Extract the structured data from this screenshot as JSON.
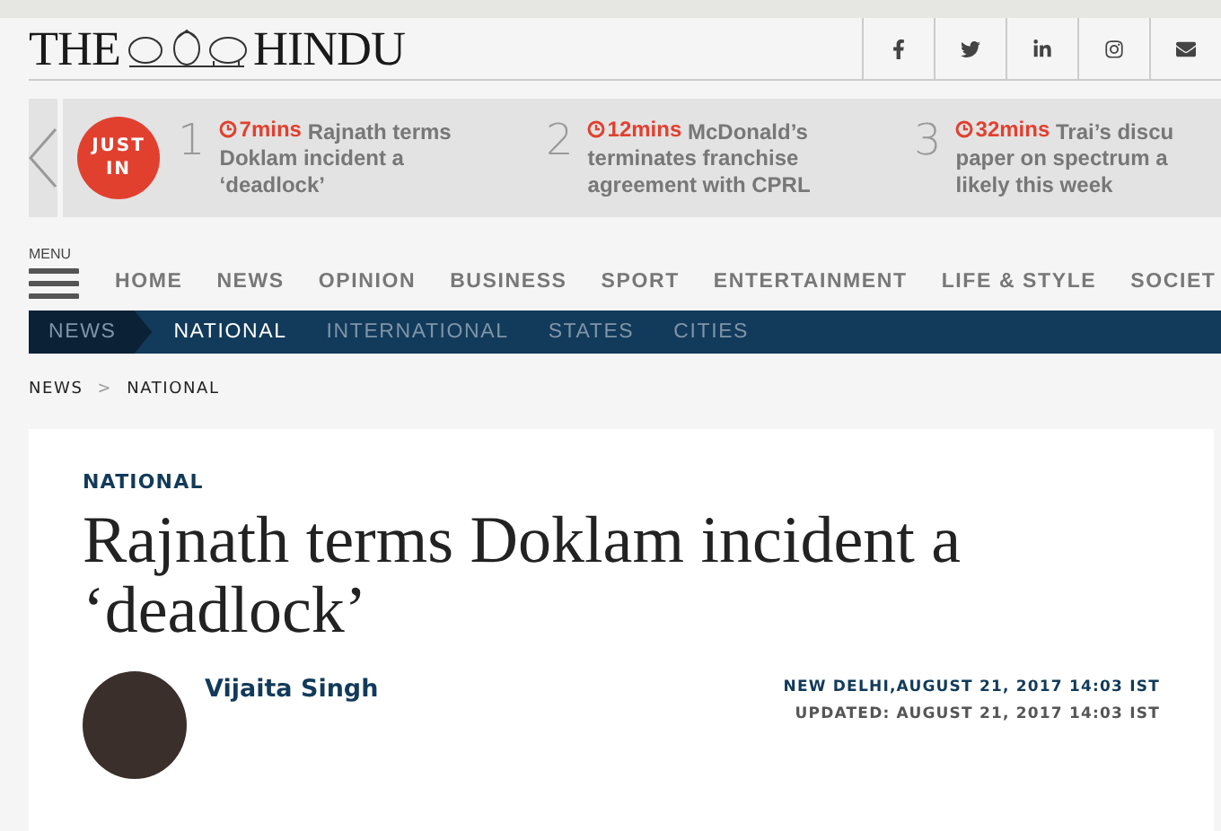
{
  "header": {
    "logo_left": "THE",
    "logo_right": "HINDU",
    "social": [
      {
        "kind": "facebook"
      },
      {
        "kind": "twitter"
      },
      {
        "kind": "linkedin"
      },
      {
        "kind": "instagram"
      },
      {
        "kind": "email"
      }
    ]
  },
  "just_in": {
    "badge": "JUST IN",
    "items": [
      {
        "number": "1",
        "time": "7mins",
        "lines": [
          "Rajnath terms",
          "Doklam incident a",
          "‘deadlock’"
        ]
      },
      {
        "number": "2",
        "time": "12mins",
        "lines": [
          "McDonald’s",
          "terminates franchise",
          "agreement with CPRL"
        ]
      },
      {
        "number": "3",
        "time": "32mins",
        "lines": [
          "Trai’s discu",
          "paper on spectrum a",
          "likely this week"
        ]
      }
    ]
  },
  "menu": {
    "label": "MENU",
    "items": [
      "HOME",
      "NEWS",
      "OPINION",
      "BUSINESS",
      "SPORT",
      "ENTERTAINMENT",
      "LIFE & STYLE",
      "SOCIET"
    ]
  },
  "subnav": {
    "section": "NEWS",
    "items": [
      {
        "label": "NATIONAL",
        "selected": true
      },
      {
        "label": "INTERNATIONAL",
        "selected": false
      },
      {
        "label": "STATES",
        "selected": false
      },
      {
        "label": "CITIES",
        "selected": false
      }
    ]
  },
  "breadcrumb": [
    "NEWS",
    "NATIONAL"
  ],
  "breadcrumb_separator": ">",
  "article": {
    "section": "NATIONAL",
    "title": "Rajnath terms Doklam incident a ‘deadlock’",
    "author": "Vijaita Singh",
    "dateline": "NEW DELHI,AUGUST 21, 2017 14:03 IST",
    "updated": "UPDATED: AUGUST 21, 2017 14:03 IST"
  }
}
